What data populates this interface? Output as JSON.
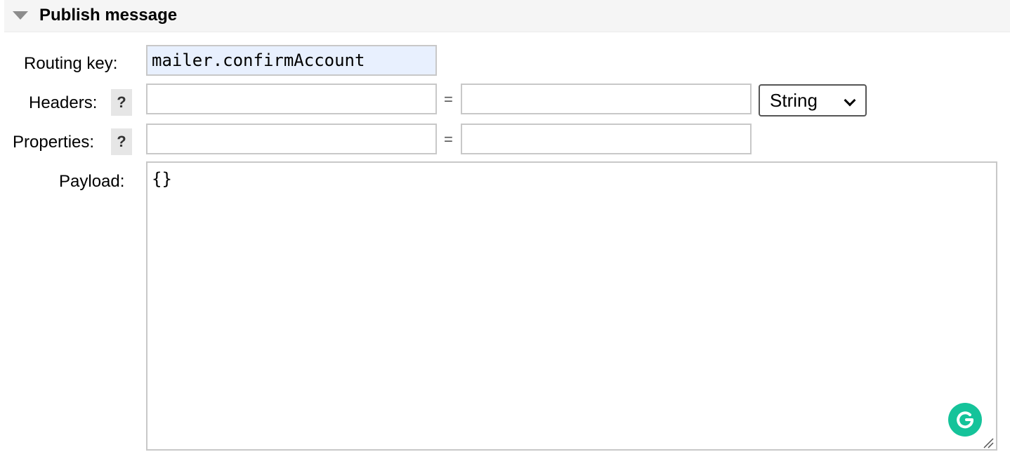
{
  "section": {
    "title": "Publish message"
  },
  "form": {
    "routing_key_label": "Routing key:",
    "routing_key_value": "mailer.confirmAccount",
    "headers_label": "Headers:",
    "headers_help": "?",
    "headers_key_value": "",
    "headers_equals": "=",
    "headers_value_value": "",
    "headers_type": "String",
    "properties_label": "Properties:",
    "properties_help": "?",
    "properties_key_value": "",
    "properties_equals": "=",
    "properties_value_value": "",
    "payload_label": "Payload:",
    "payload_value": "{}"
  },
  "icons": {
    "collapse": "triangle-down-icon",
    "grammarly": "grammarly-icon",
    "resize": "resize-handle-icon"
  },
  "colors": {
    "grammarly": "#15c39a",
    "autofill_bg": "#e8f0fe"
  }
}
